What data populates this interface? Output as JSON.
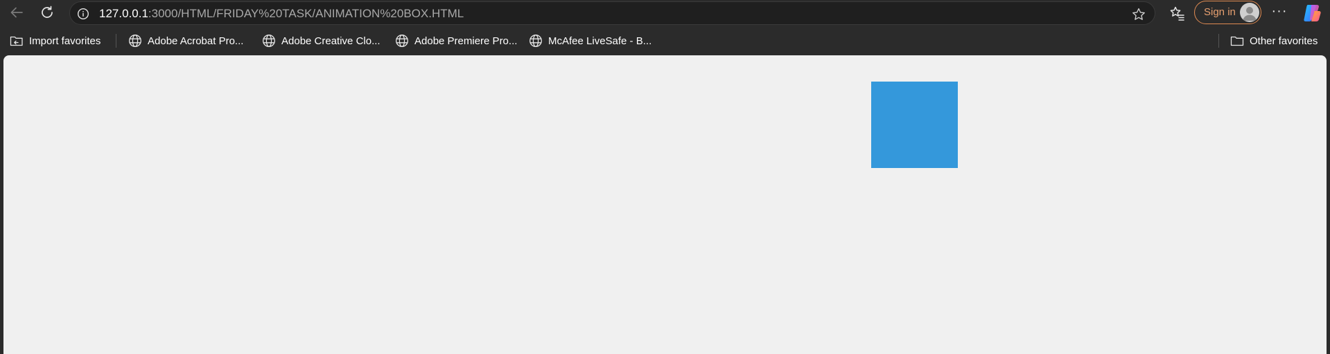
{
  "toolbar": {
    "url_host": "127.0.0.1",
    "url_rest": ":3000/HTML/FRIDAY%20TASK/ANIMATION%20BOX.HTML",
    "sign_in_label": "Sign in",
    "more_label": "···"
  },
  "favorites": {
    "items": [
      {
        "label": "Import favorites",
        "icon": "import-favorites-icon"
      },
      {
        "label": "Adobe Acrobat Pro...",
        "icon": "globe-icon"
      },
      {
        "label": "Adobe Creative Clo...",
        "icon": "globe-icon"
      },
      {
        "label": "Adobe Premiere Pro...",
        "icon": "globe-icon"
      },
      {
        "label": "McAfee LiveSafe - B...",
        "icon": "globe-icon"
      }
    ],
    "other_label": "Other favorites"
  },
  "page": {
    "background": "#f0f0f0",
    "box_color": "#3498db"
  }
}
